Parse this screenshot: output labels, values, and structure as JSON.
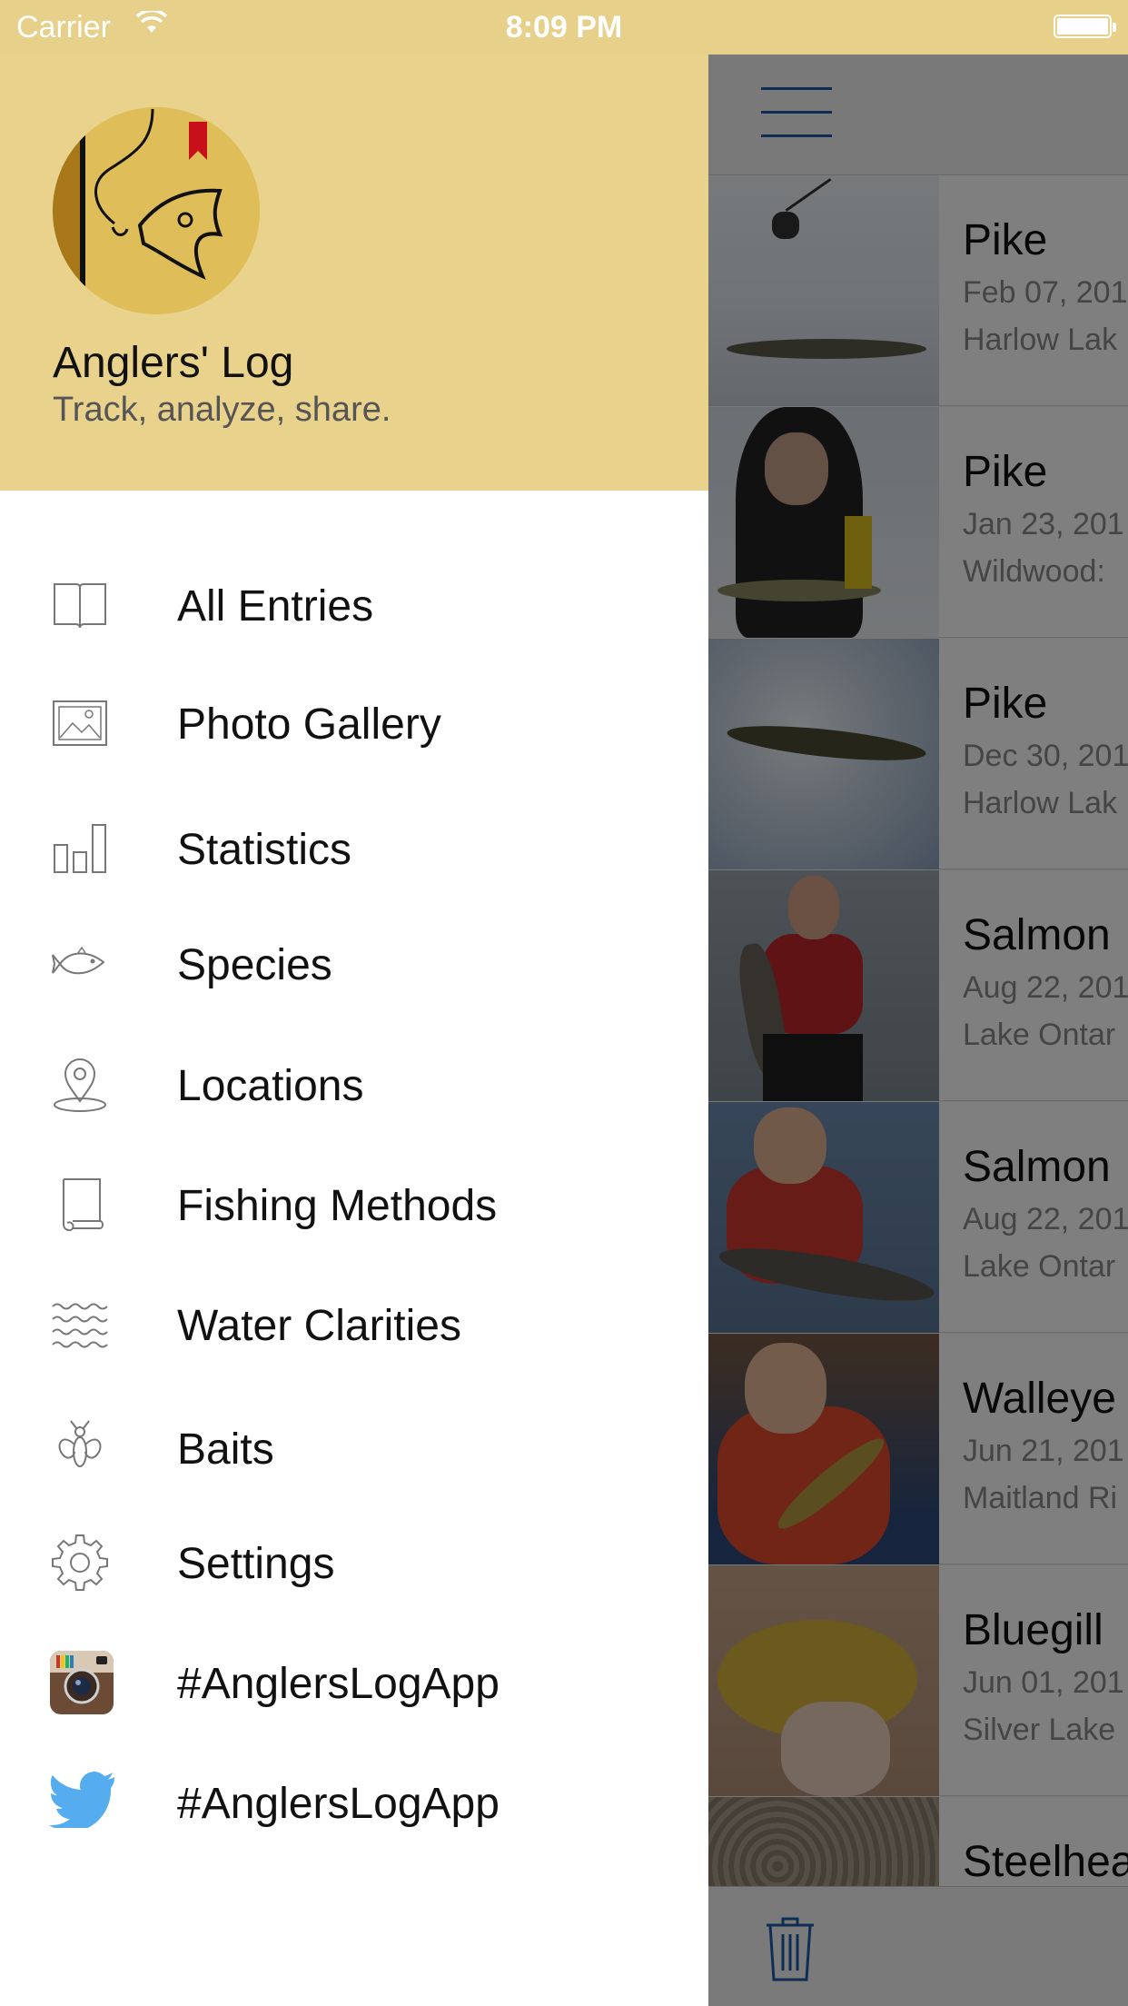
{
  "status_bar": {
    "carrier": "Carrier",
    "time": "8:09 PM"
  },
  "drawer": {
    "title": "Anglers' Log",
    "subtitle": "Track, analyze, share.",
    "items": [
      {
        "label": "All Entries",
        "icon": "book-icon"
      },
      {
        "label": "Photo Gallery",
        "icon": "photo-icon"
      },
      {
        "label": "Statistics",
        "icon": "bar-chart-icon"
      },
      {
        "label": "Species",
        "icon": "fish-icon"
      },
      {
        "label": "Locations",
        "icon": "map-pin-icon"
      },
      {
        "label": "Fishing Methods",
        "icon": "scroll-icon"
      },
      {
        "label": "Water Clarities",
        "icon": "waves-icon"
      },
      {
        "label": "Baits",
        "icon": "fly-icon"
      },
      {
        "label": "Settings",
        "icon": "gear-icon"
      },
      {
        "label": "#AnglersLogApp",
        "icon": "instagram-icon"
      },
      {
        "label": "#AnglersLogApp",
        "icon": "twitter-icon"
      }
    ]
  },
  "entries": [
    {
      "species": "Pike",
      "date": "Feb 07, 201",
      "location": "Harlow Lak"
    },
    {
      "species": "Pike",
      "date": "Jan 23, 201",
      "location": "Wildwood:"
    },
    {
      "species": "Pike",
      "date": "Dec 30, 201",
      "location": "Harlow Lak"
    },
    {
      "species": "Salmon",
      "date": "Aug 22, 201",
      "location": "Lake Ontar"
    },
    {
      "species": "Salmon",
      "date": "Aug 22, 201",
      "location": "Lake Ontar"
    },
    {
      "species": "Walleye",
      "date": "Jun 21, 201",
      "location": "Maitland Ri"
    },
    {
      "species": "Bluegill",
      "date": "Jun 01, 201",
      "location": "Silver Lake"
    },
    {
      "species": "Steelhea",
      "date": "",
      "location": ""
    }
  ],
  "colors": {
    "header": "#e9d38c",
    "status_bar": "#e6d08a",
    "accent": "#1e5aa8"
  }
}
